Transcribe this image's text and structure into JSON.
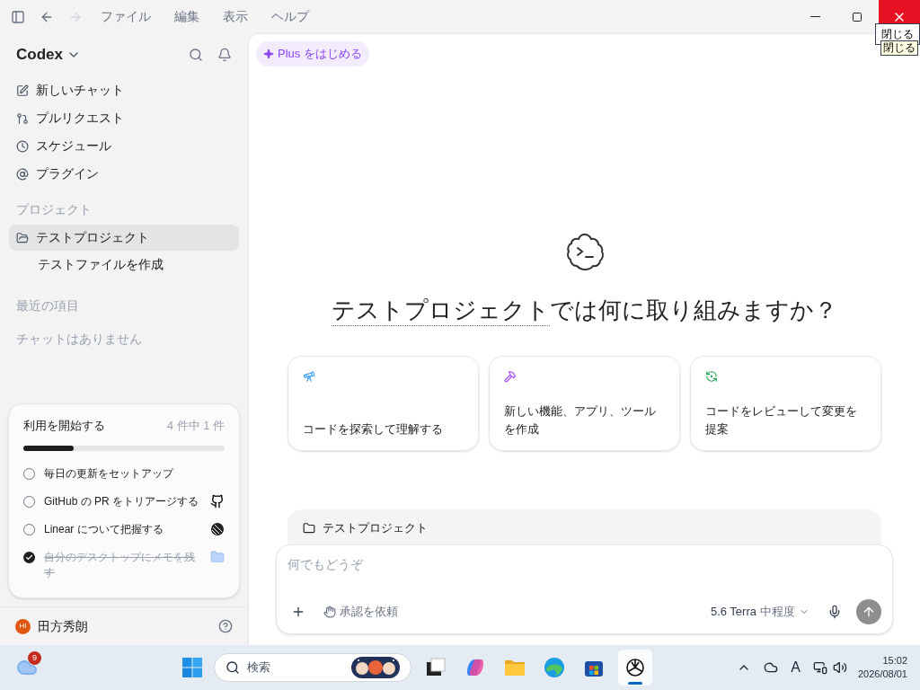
{
  "menu_bar": {
    "menus": [
      "ファイル",
      "編集",
      "表示",
      "ヘルプ"
    ]
  },
  "tooltips": [
    "閉じる",
    "閉じる"
  ],
  "sidebar": {
    "app_name": "Codex",
    "nav": [
      {
        "kind": "new",
        "label": "新しいチャット"
      },
      {
        "kind": "pull",
        "label": "プルリクエスト"
      },
      {
        "kind": "schedule",
        "label": "スケジュール"
      },
      {
        "kind": "plugin",
        "label": "プラグイン"
      }
    ],
    "projects_heading": "プロジェクト",
    "projects": [
      {
        "label": "テストプロジェクト",
        "selected": true,
        "children": [
          {
            "label": "テストファイルを作成",
            "selected": false
          }
        ]
      }
    ],
    "recent_heading": "最近の項目",
    "recent_empty": "チャットはありません",
    "onboarding": {
      "title": "利用を開始する",
      "count": "4 件中 1 件",
      "level": 0.25,
      "tasks": [
        {
          "label": "毎日の更新をセットアップ",
          "checked": false,
          "kind": "plain"
        },
        {
          "label": "GitHub の PR をトリアージする",
          "checked": false,
          "kind": "github"
        },
        {
          "label": "Linear について把握する",
          "checked": false,
          "kind": "linear"
        },
        {
          "label": "自分のデスクトップにメモを残す",
          "checked": true,
          "kind": "folder"
        }
      ]
    },
    "user": {
      "initials": "HI",
      "name": "田方秀朗"
    }
  },
  "main": {
    "upgrade": "Plus をはじめる",
    "heading_project": "テストプロジェクト",
    "heading_rest": "では何に取り組みますか？",
    "cards": [
      {
        "kind": "explore",
        "label": "コードを探索して理解する"
      },
      {
        "kind": "build",
        "label": "新しい機能、アプリ、ツールを作成"
      },
      {
        "kind": "review",
        "label": "コードをレビューして変更を提案"
      }
    ],
    "composer": {
      "project": "テストプロジェクト",
      "placeholder": "何でもどうぞ",
      "approval": "承認を依頼",
      "model": "5.6 Terra",
      "effort": "中程度"
    }
  },
  "taskbar": {
    "weather_badge": "9",
    "search_placeholder": "検索",
    "ime": "A",
    "time": "15:02",
    "date": "2026/08/01"
  }
}
